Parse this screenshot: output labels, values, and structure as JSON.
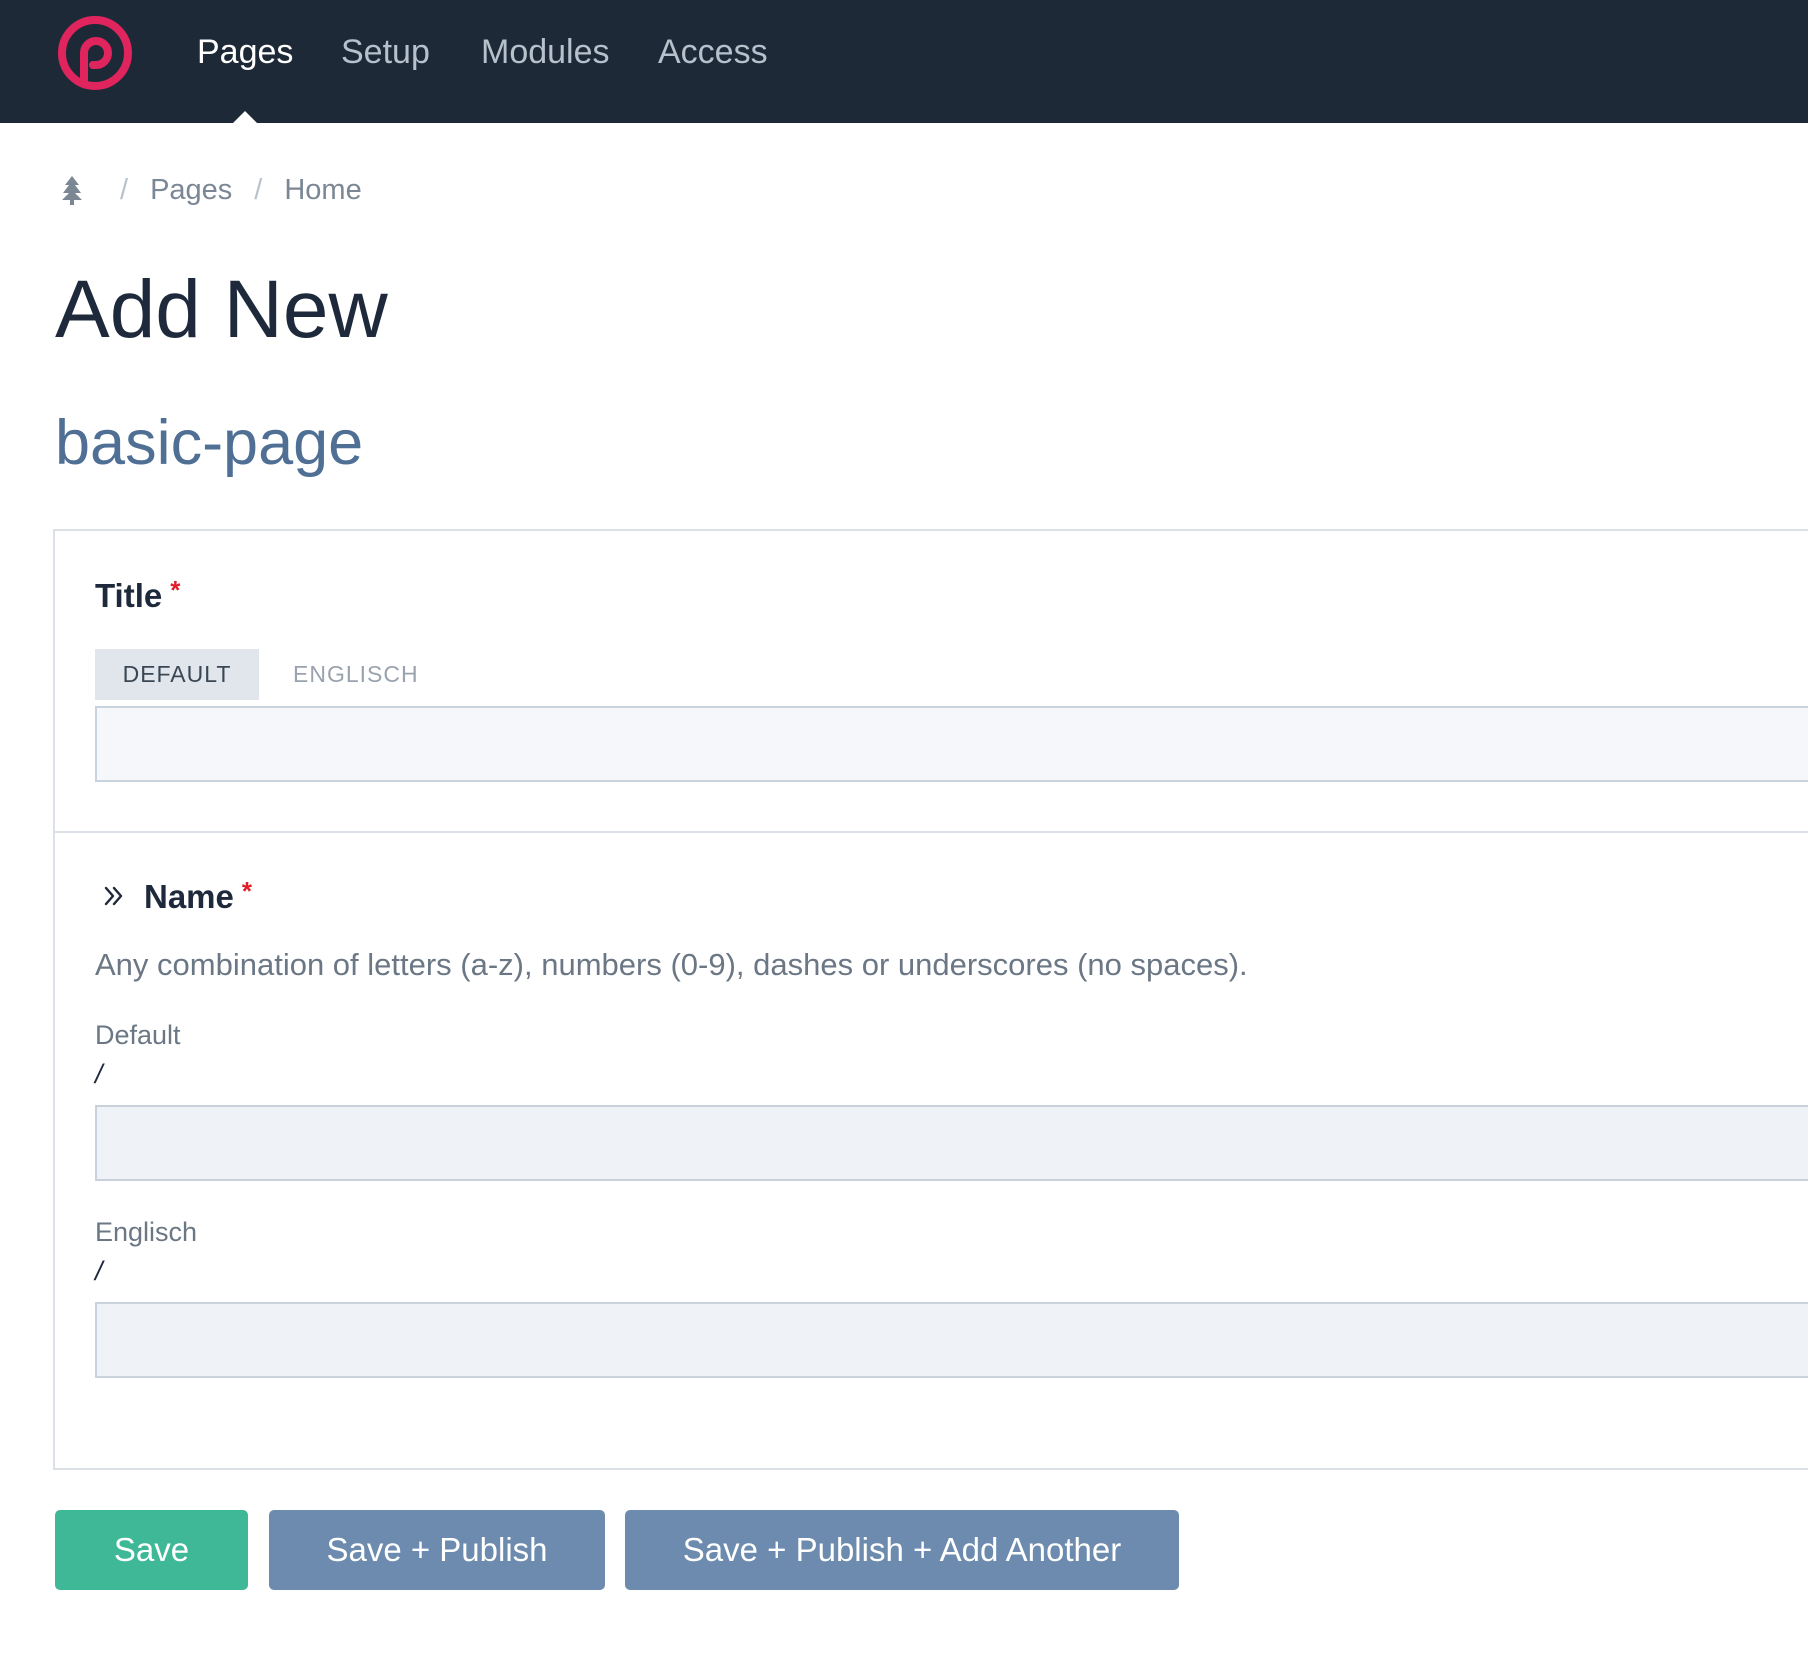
{
  "nav": {
    "items": [
      {
        "label": "Pages",
        "active": true
      },
      {
        "label": "Setup",
        "active": false
      },
      {
        "label": "Modules",
        "active": false
      },
      {
        "label": "Access",
        "active": false
      }
    ],
    "brand_color": "#e0245e",
    "bar_color": "#1e2937"
  },
  "breadcrumb": {
    "home_icon": "tree-icon",
    "items": [
      "Pages",
      "Home"
    ],
    "separator": "/"
  },
  "page": {
    "title": "Add New",
    "template": "basic-page"
  },
  "title_field": {
    "label": "Title",
    "required_mark": "*",
    "tabs": [
      {
        "label": "DEFAULT",
        "active": true
      },
      {
        "label": "ENGLISCH",
        "active": false
      }
    ],
    "value": ""
  },
  "name_field": {
    "label": "Name",
    "required_mark": "*",
    "toggle_icon": "double-chevron-right-icon",
    "description": "Any combination of letters (a-z), numbers (0-9), dashes or underscores (no spaces).",
    "languages": [
      {
        "label": "Default",
        "prefix": "/",
        "value": ""
      },
      {
        "label": "Englisch",
        "prefix": "/",
        "value": ""
      }
    ]
  },
  "actions": {
    "save": "Save",
    "save_publish": "Save + Publish",
    "save_publish_add": "Save + Publish + Add Another",
    "save_color": "#3fb897",
    "publish_color": "#6d8bae"
  }
}
